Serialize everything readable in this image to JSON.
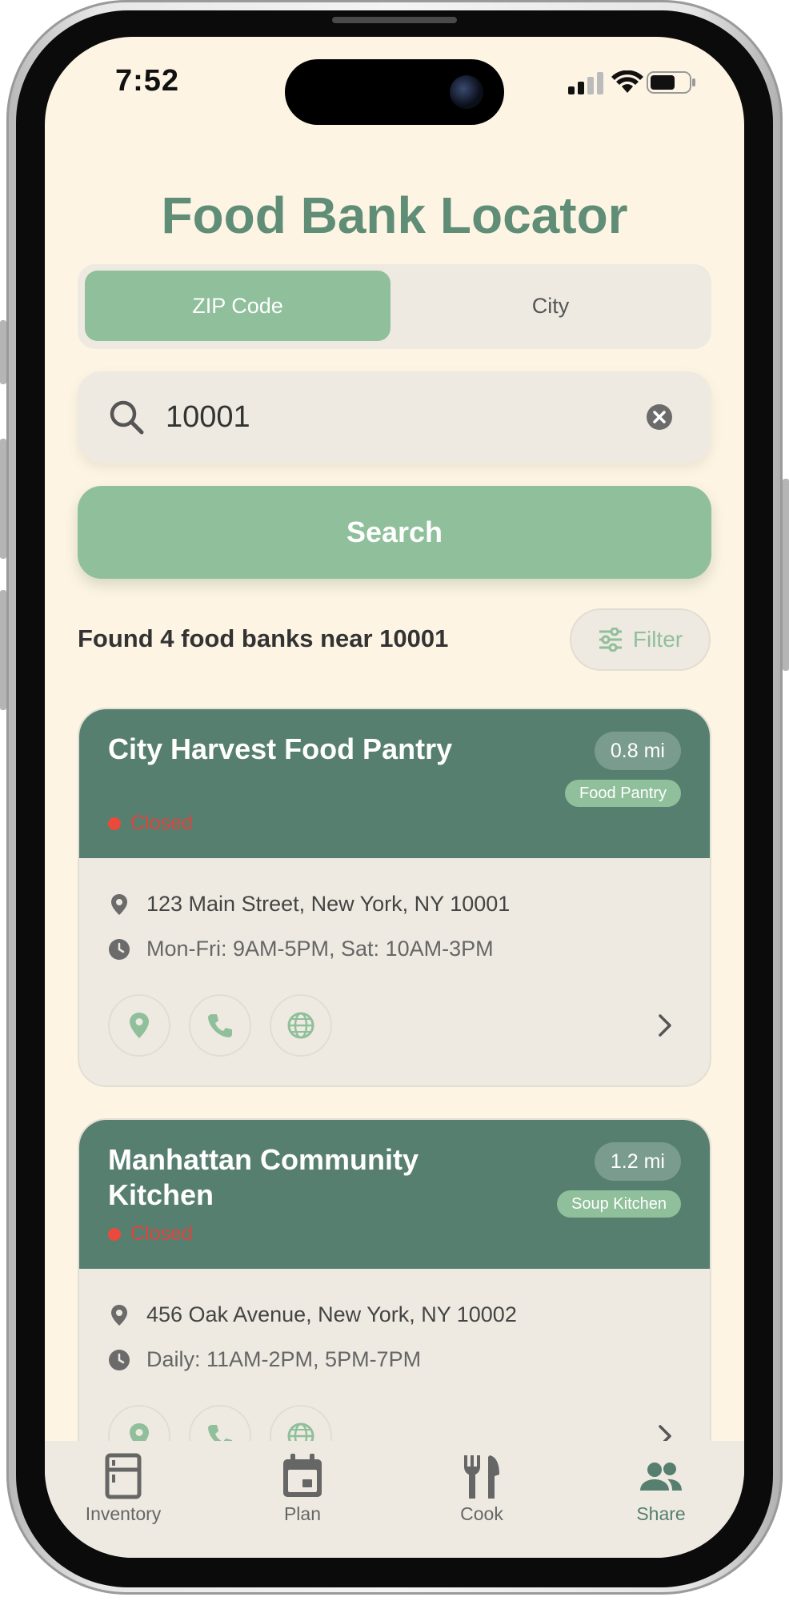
{
  "status_bar": {
    "time": "7:52"
  },
  "title": "Food Bank Locator",
  "search_mode": {
    "options": [
      "ZIP Code",
      "City"
    ],
    "selected": "ZIP Code"
  },
  "search": {
    "value": "10001"
  },
  "search_button_label": "Search",
  "results": {
    "summary": "Found 4 food banks near 10001",
    "filter_label": "Filter"
  },
  "cards": [
    {
      "name": "City Harvest Food Pantry",
      "distance": "0.8 mi",
      "type": "Food Pantry",
      "status": "Closed",
      "address": "123 Main Street, New York, NY 10001",
      "hours": "Mon-Fri: 9AM-5PM, Sat: 10AM-3PM"
    },
    {
      "name": "Manhattan Community Kitchen",
      "distance": "1.2 mi",
      "type": "Soup Kitchen",
      "status": "Closed",
      "address": "456 Oak Avenue, New York, NY 10002",
      "hours": "Daily: 11AM-2PM, 5PM-7PM"
    }
  ],
  "tabs": [
    {
      "label": "Inventory",
      "icon": "fridge-icon"
    },
    {
      "label": "Plan",
      "icon": "calendar-icon"
    },
    {
      "label": "Cook",
      "icon": "fork-knife-icon"
    },
    {
      "label": "Share",
      "icon": "people-icon",
      "active": true
    }
  ],
  "colors": {
    "background": "#fdf4e3",
    "accent": "#8fbf9b",
    "card_header": "#567f70",
    "title": "#5f8d76",
    "closed": "#e94a3c"
  }
}
